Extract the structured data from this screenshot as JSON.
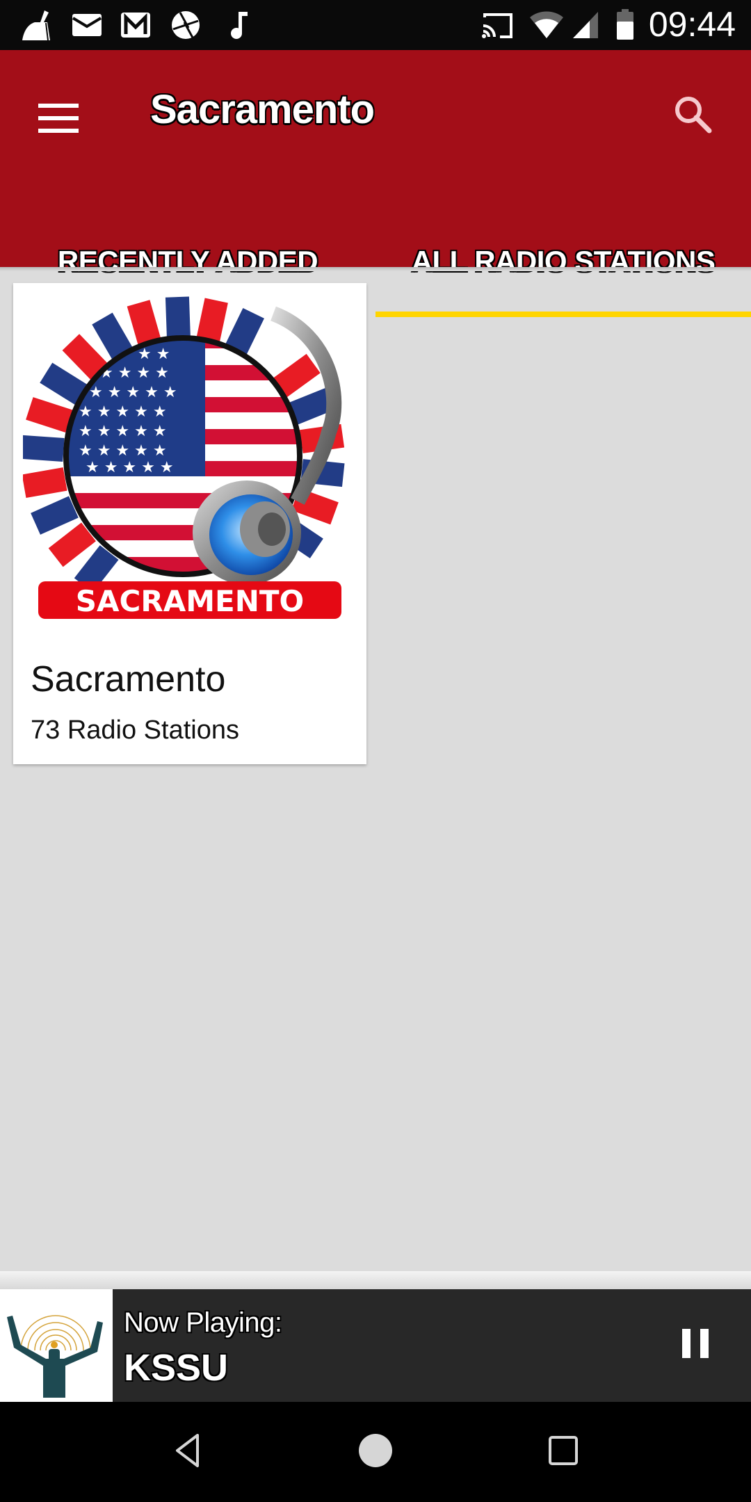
{
  "status_bar": {
    "left_icons": [
      "cleaner-broom-icon",
      "email-icon",
      "gmail-icon",
      "camera-aperture-icon",
      "music-note-icon"
    ],
    "right_icons": [
      "cast-icon",
      "wifi-icon",
      "cell-signal-icon",
      "battery-icon"
    ],
    "time": "09:44"
  },
  "app_bar": {
    "title": "Sacramento",
    "menu_icon": "hamburger-menu-icon",
    "search_icon": "search-icon",
    "background_color": "#a30e18",
    "tabs": [
      {
        "label": "RECENTLY ADDED",
        "active": false
      },
      {
        "label": "ALL RADIO STATIONS",
        "active": true
      }
    ],
    "indicator_color": "#ffd500"
  },
  "content": {
    "cards": [
      {
        "image_label": "SACRAMENTO",
        "name": "Sacramento",
        "subtitle": "73 Radio Stations"
      }
    ]
  },
  "player": {
    "label": "Now Playing:",
    "station": "KSSU",
    "control_icon": "pause-icon"
  },
  "nav_bar": {
    "buttons": [
      "back-icon",
      "home-icon",
      "recents-icon"
    ]
  }
}
